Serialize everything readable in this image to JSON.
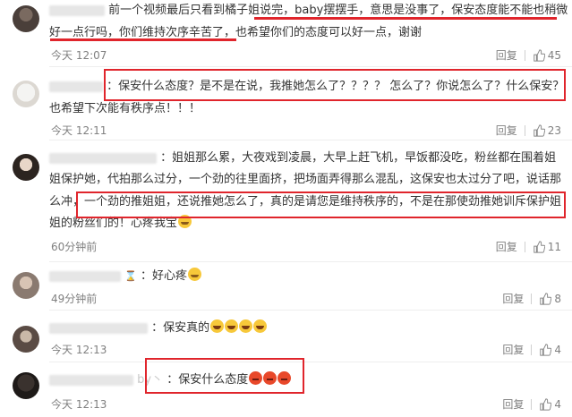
{
  "comments": [
    {
      "line1": "前一个视频最后只看到橘子姐说完，baby摆摆手，意思是没事了，保安态度能不能也稍微",
      "line2": "好一点行吗，你们维持次序辛苦了，也希望你们的态度可以好一点，谢谢",
      "time": "今天 12:07",
      "reply": "回复",
      "likes": "45"
    },
    {
      "line1": "：保安什么态度？是不是在说，我推她怎么了？？？？ 怎么了？你说怎么了？什么保安？",
      "line2": "也希望下次能有秩序点！！！",
      "time": "今天 12:11",
      "reply": "回复",
      "likes": "23"
    },
    {
      "line1": "：姐姐那么累，大夜戏到凌晨，大早上赶飞机，早饭都没吃，粉丝都在围着姐",
      "line2": "姐保护她，代拍那么过分，一个劲的往里面挤，把场面弄得那么混乱，这保安也太过分了吧，说话那",
      "line3": "么冲，一个劲的推姐姐，还说推她怎么了，真的是请您是维持秩序的，不是在那使劲推她训斥保护姐",
      "line4": "姐的粉丝们的！心疼我宝",
      "time": "60分钟前",
      "reply": "回复",
      "likes": "11"
    },
    {
      "line1": "：好心疼",
      "time": "49分钟前",
      "reply": "回复",
      "likes": "8"
    },
    {
      "line1": "：保安真的",
      "time": "今天 12:13",
      "reply": "回复",
      "likes": "4"
    },
    {
      "line1": "：保安什么态度",
      "time": "今天 12:13",
      "reply": "回复",
      "likes": "4"
    }
  ],
  "icons": {
    "like": "thumbs-up-icon",
    "cry_emoji": "crying-face-emoji",
    "laugh_emoji": "laughing-tears-emoji",
    "angry_emoji": "angry-face-emoji"
  },
  "colors": {
    "highlight": "#e0252c",
    "meta_text": "#808080",
    "body_text": "#333333"
  }
}
